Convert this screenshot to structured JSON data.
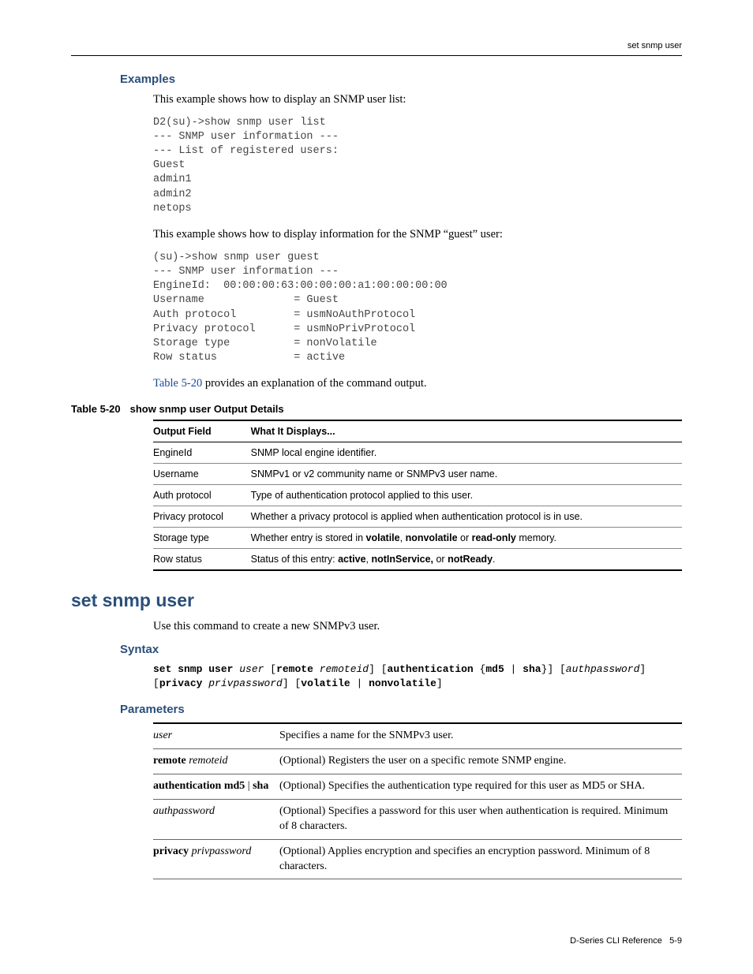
{
  "running_head": "set snmp user",
  "examples_heading": "Examples",
  "intro1": "This example shows how to display an SNMP user list:",
  "code1": "D2(su)->show snmp user list\n--- SNMP user information ---\n--- List of registered users: \nGuest\nadmin1\nadmin2\nnetops",
  "intro2": "This example shows how to display information for the SNMP “guest” user:",
  "code2": "(su)->show snmp user guest\n--- SNMP user information ---  \nEngineId:  00:00:00:63:00:00:00:a1:00:00:00:00 \nUsername              = Guest  \nAuth protocol         = usmNoAuthProtocol \nPrivacy protocol      = usmNoPrivProtocol \nStorage type          = nonVolatile  \nRow status            = active  ",
  "table_ref_link": "Table 5-20",
  "table_ref_rest": " provides an explanation of the command output.",
  "table_caption_num": "Table 5-20",
  "table_caption_title": "show snmp user Output Details",
  "out_table": {
    "headers": [
      "Output Field",
      "What It Displays..."
    ],
    "rows": [
      [
        "EngineId",
        "SNMP local engine identifier."
      ],
      [
        "Username",
        "SNMPv1 or v2 community name or SNMPv3 user name."
      ],
      [
        "Auth protocol",
        "Type of authentication protocol applied to this user."
      ],
      [
        "Privacy protocol",
        "Whether a privacy protocol is applied when authentication protocol is in use."
      ],
      [
        "Storage type",
        "Whether entry is stored in <b>volatile</b>, <b>nonvolatile</b> or <b>read-only</b> memory."
      ],
      [
        "Row status",
        "Status of this entry: <b>active</b>, <b>notInService,</b> or <b>notReady</b>."
      ]
    ]
  },
  "h1": "set snmp user",
  "h1_intro": "Use this command to create a new SNMPv3 user.",
  "syntax_heading": "Syntax",
  "syntax_line": "<span class='b'>set snmp user</span> <span class='i'>user</span> [<span class='b'>remote</span> <span class='i'>remoteid</span>] [<span class='b'>authentication</span> {<span class='b'>md5</span> | <span class='b'>sha</span>}] [<span class='i'>authpassword</span>] [<span class='b'>privacy</span> <span class='i'>privpassword</span>] [<span class='b'>volatile</span> | <span class='b'>nonvolatile</span>]",
  "params_heading": "Parameters",
  "params_rows": [
    [
      "<span class='pi'>user</span>",
      "Specifies a name for the SNMPv3 user."
    ],
    [
      "<span class='pb'>remote</span> <span class='pi'>remoteid</span>",
      "(Optional) Registers the user on a specific remote SNMP engine."
    ],
    [
      "<span class='pb'>authentication md5</span> | <span class='pb'>sha</span>",
      "(Optional) Specifies the authentication type required for this user as MD5 or SHA."
    ],
    [
      "<span class='pi'>authpassword</span>",
      "(Optional) Specifies a password for this user when authentication is required. Minimum of 8 characters."
    ],
    [
      "<span class='pb'>privacy</span> <span class='pi'>privpassword</span>",
      "(Optional) Applies encryption and specifies an encryption password. Minimum of 8 characters."
    ]
  ],
  "footer_left": "D-Series CLI Reference",
  "footer_right": "5-9"
}
